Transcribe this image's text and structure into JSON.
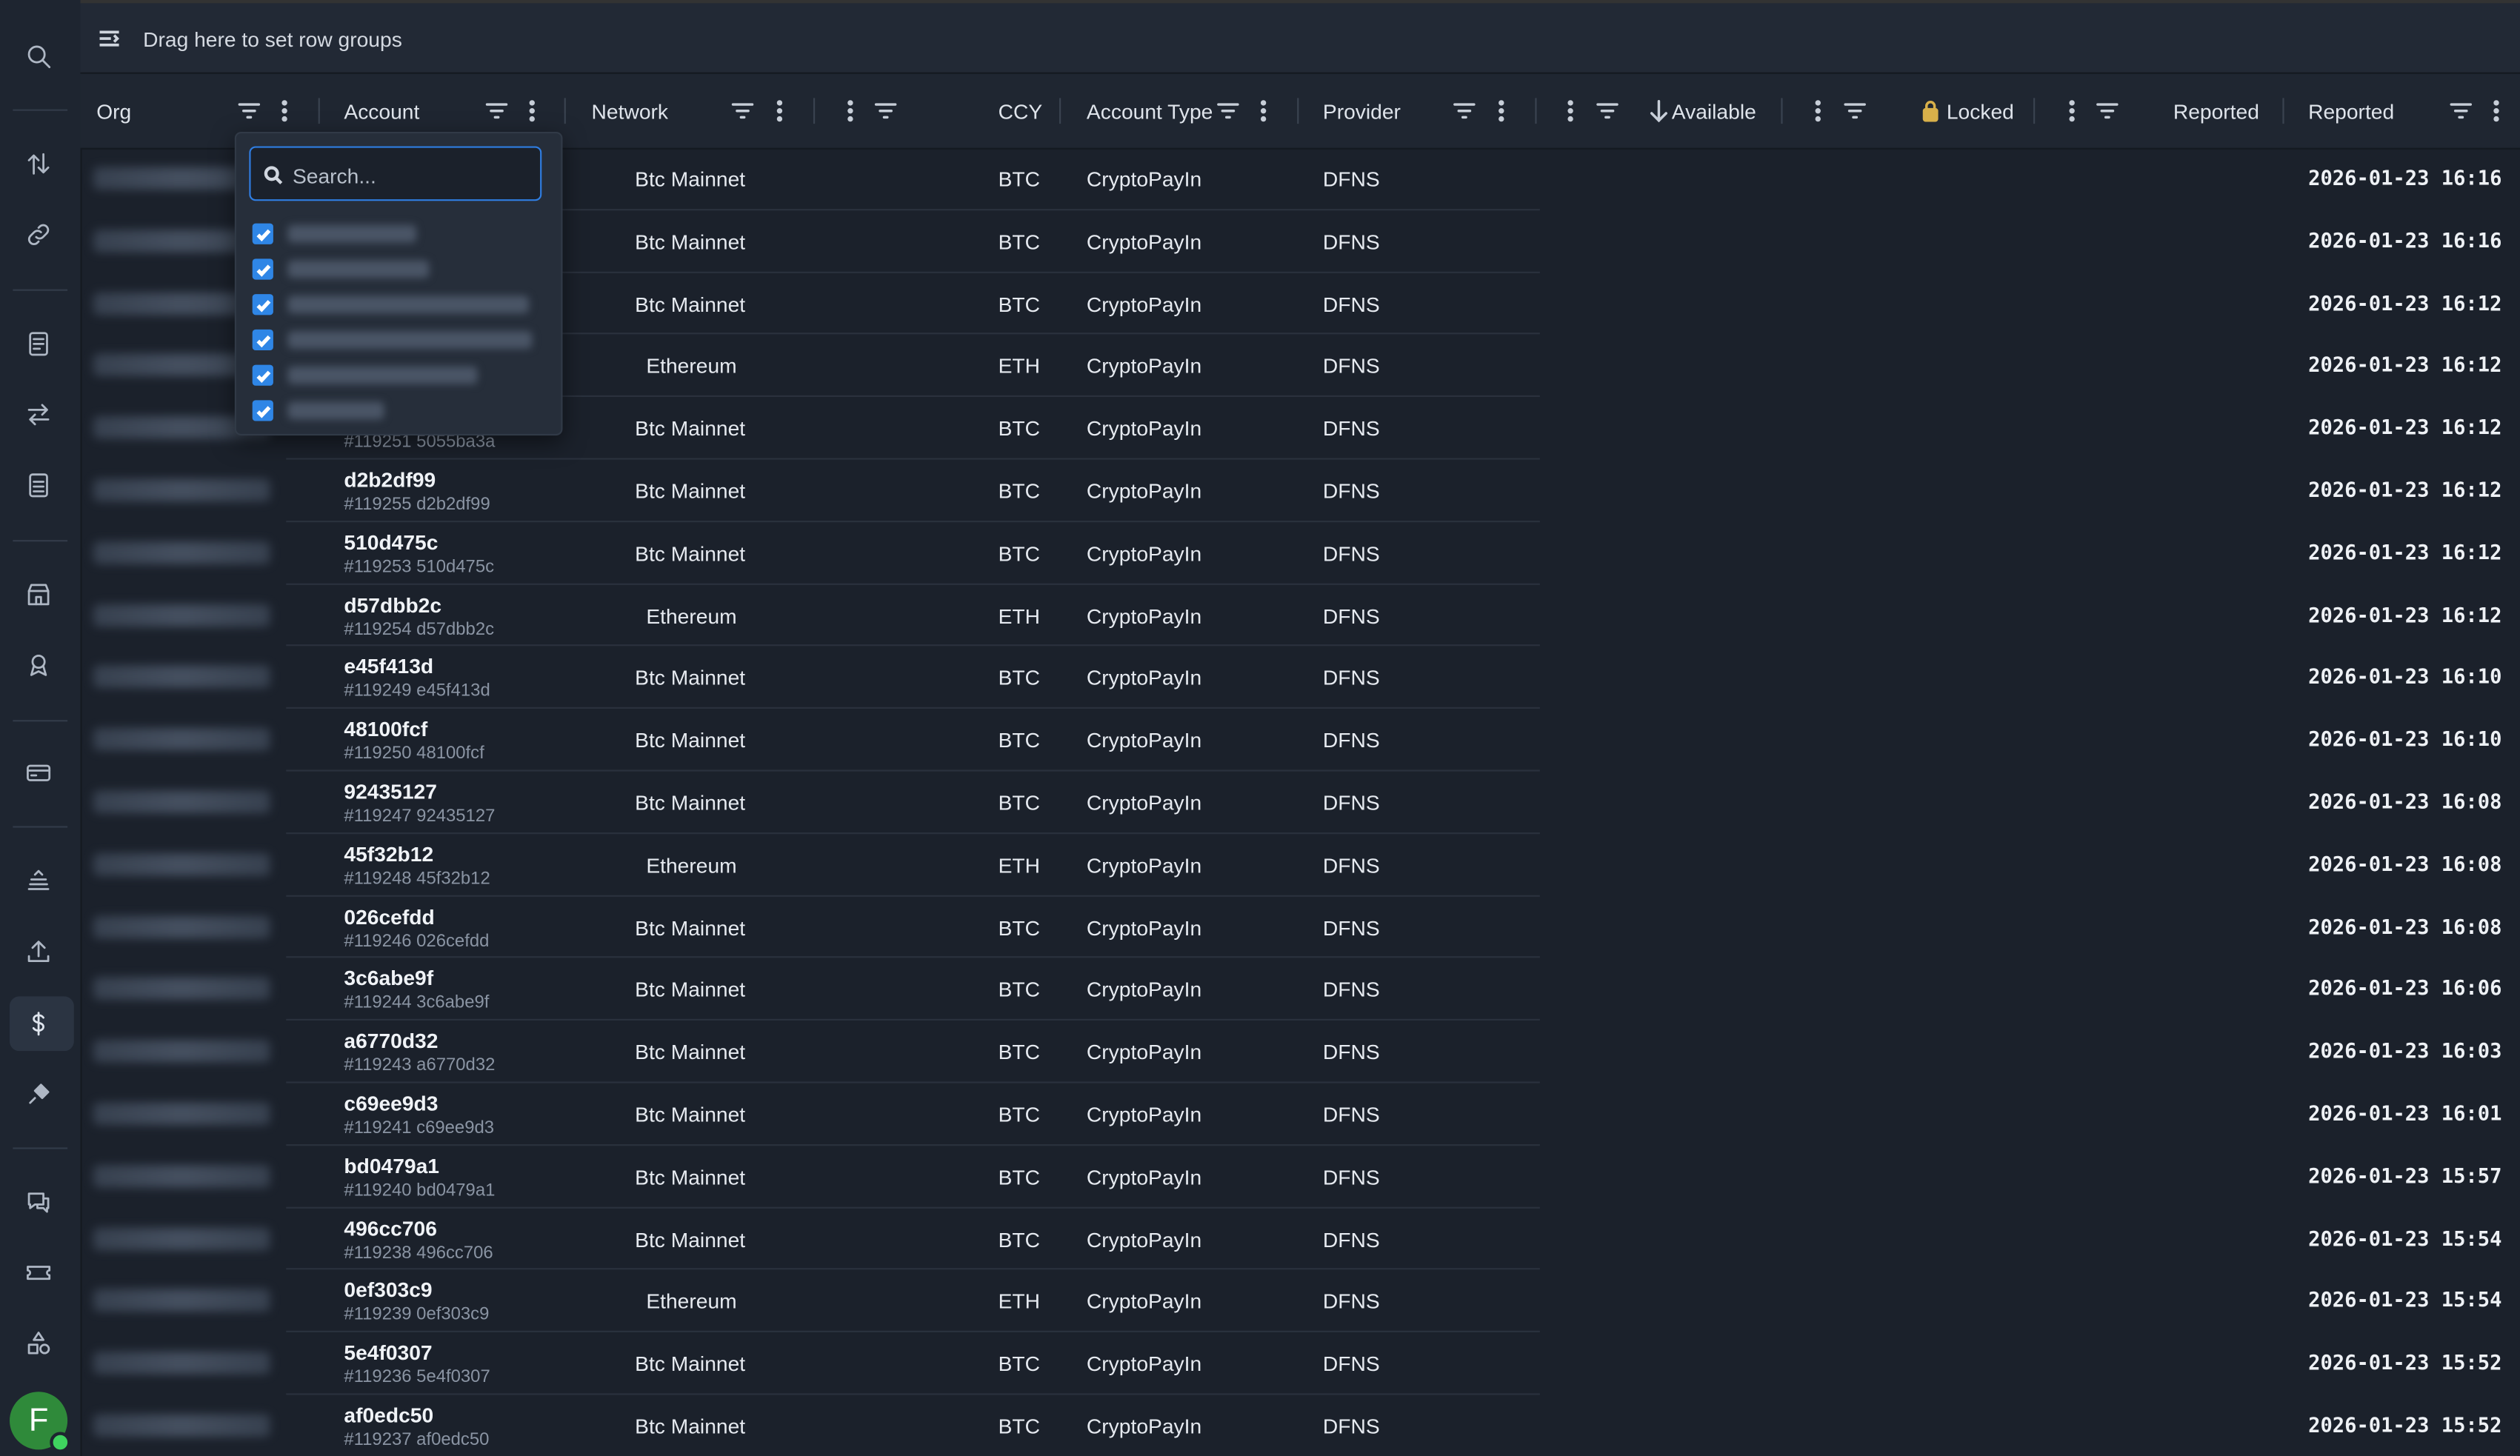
{
  "group_bar": {
    "text": "Drag here to set row groups"
  },
  "columns": {
    "org": "Org",
    "account": "Account",
    "network": "Network",
    "ccy": "CCY",
    "account_type": "Account Type",
    "provider": "Provider",
    "available": "Available",
    "locked": "Locked",
    "reported1": "Reported",
    "reported2": "Reported"
  },
  "filter_popup": {
    "search_placeholder": "Search..."
  },
  "rows": [
    {
      "account": "",
      "sub": "",
      "network": "Btc Mainnet",
      "ccy": "BTC",
      "type": "CryptoPayIn",
      "provider": "DFNS",
      "reported": "2026-01-23 16:16"
    },
    {
      "account": "",
      "sub": "",
      "network": "Btc Mainnet",
      "ccy": "BTC",
      "type": "CryptoPayIn",
      "provider": "DFNS",
      "reported": "2026-01-23 16:16"
    },
    {
      "account": "",
      "sub": "",
      "network": "Btc Mainnet",
      "ccy": "BTC",
      "type": "CryptoPayIn",
      "provider": "DFNS",
      "reported": "2026-01-23 16:12"
    },
    {
      "account": "",
      "sub": "",
      "network": "Ethereum",
      "ccy": "ETH",
      "type": "CryptoPayIn",
      "provider": "DFNS",
      "reported": "2026-01-23 16:12"
    },
    {
      "account": "",
      "sub": "#119251 5055ba3a",
      "network": "Btc Mainnet",
      "ccy": "BTC",
      "type": "CryptoPayIn",
      "provider": "DFNS",
      "reported": "2026-01-23 16:12"
    },
    {
      "account": "d2b2df99",
      "sub": "#119255 d2b2df99",
      "network": "Btc Mainnet",
      "ccy": "BTC",
      "type": "CryptoPayIn",
      "provider": "DFNS",
      "reported": "2026-01-23 16:12"
    },
    {
      "account": "510d475c",
      "sub": "#119253 510d475c",
      "network": "Btc Mainnet",
      "ccy": "BTC",
      "type": "CryptoPayIn",
      "provider": "DFNS",
      "reported": "2026-01-23 16:12"
    },
    {
      "account": "d57dbb2c",
      "sub": "#119254 d57dbb2c",
      "network": "Ethereum",
      "ccy": "ETH",
      "type": "CryptoPayIn",
      "provider": "DFNS",
      "reported": "2026-01-23 16:12"
    },
    {
      "account": "e45f413d",
      "sub": "#119249 e45f413d",
      "network": "Btc Mainnet",
      "ccy": "BTC",
      "type": "CryptoPayIn",
      "provider": "DFNS",
      "reported": "2026-01-23 16:10"
    },
    {
      "account": "48100fcf",
      "sub": "#119250 48100fcf",
      "network": "Btc Mainnet",
      "ccy": "BTC",
      "type": "CryptoPayIn",
      "provider": "DFNS",
      "reported": "2026-01-23 16:10"
    },
    {
      "account": "92435127",
      "sub": "#119247 92435127",
      "network": "Btc Mainnet",
      "ccy": "BTC",
      "type": "CryptoPayIn",
      "provider": "DFNS",
      "reported": "2026-01-23 16:08"
    },
    {
      "account": "45f32b12",
      "sub": "#119248 45f32b12",
      "network": "Ethereum",
      "ccy": "ETH",
      "type": "CryptoPayIn",
      "provider": "DFNS",
      "reported": "2026-01-23 16:08"
    },
    {
      "account": "026cefdd",
      "sub": "#119246 026cefdd",
      "network": "Btc Mainnet",
      "ccy": "BTC",
      "type": "CryptoPayIn",
      "provider": "DFNS",
      "reported": "2026-01-23 16:08"
    },
    {
      "account": "3c6abe9f",
      "sub": "#119244 3c6abe9f",
      "network": "Btc Mainnet",
      "ccy": "BTC",
      "type": "CryptoPayIn",
      "provider": "DFNS",
      "reported": "2026-01-23 16:06"
    },
    {
      "account": "a6770d32",
      "sub": "#119243 a6770d32",
      "network": "Btc Mainnet",
      "ccy": "BTC",
      "type": "CryptoPayIn",
      "provider": "DFNS",
      "reported": "2026-01-23 16:03"
    },
    {
      "account": "c69ee9d3",
      "sub": "#119241 c69ee9d3",
      "network": "Btc Mainnet",
      "ccy": "BTC",
      "type": "CryptoPayIn",
      "provider": "DFNS",
      "reported": "2026-01-23 16:01"
    },
    {
      "account": "bd0479a1",
      "sub": "#119240 bd0479a1",
      "network": "Btc Mainnet",
      "ccy": "BTC",
      "type": "CryptoPayIn",
      "provider": "DFNS",
      "reported": "2026-01-23 15:57"
    },
    {
      "account": "496cc706",
      "sub": "#119238 496cc706",
      "network": "Btc Mainnet",
      "ccy": "BTC",
      "type": "CryptoPayIn",
      "provider": "DFNS",
      "reported": "2026-01-23 15:54"
    },
    {
      "account": "0ef303c9",
      "sub": "#119239 0ef303c9",
      "network": "Ethereum",
      "ccy": "ETH",
      "type": "CryptoPayIn",
      "provider": "DFNS",
      "reported": "2026-01-23 15:54"
    },
    {
      "account": "5e4f0307",
      "sub": "#119236 5e4f0307",
      "network": "Btc Mainnet",
      "ccy": "BTC",
      "type": "CryptoPayIn",
      "provider": "DFNS",
      "reported": "2026-01-23 15:52"
    },
    {
      "account": "af0edc50",
      "sub": "#119237 af0edc50",
      "network": "Btc Mainnet",
      "ccy": "BTC",
      "type": "CryptoPayIn",
      "provider": "DFNS",
      "reported": "2026-01-23 15:52"
    }
  ],
  "user": {
    "avatar_initial": "F"
  }
}
